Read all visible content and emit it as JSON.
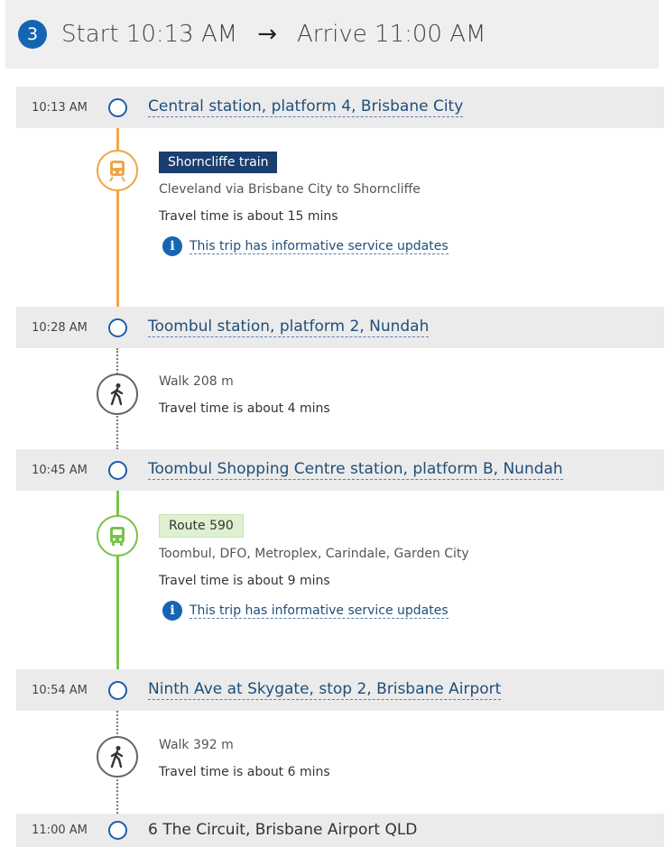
{
  "header": {
    "step_number": "3",
    "start": "Start 10:13 AM",
    "arrow": "→",
    "arrive": "Arrive 11:00 AM"
  },
  "stops": [
    {
      "time": "10:13 AM",
      "name": "Central station, platform 4, Brisbane City"
    },
    {
      "time": "10:28 AM",
      "name": "Toombul station, platform 2, Nundah"
    },
    {
      "time": "10:45 AM",
      "name": "Toombul Shopping Centre station, platform B, Nundah"
    },
    {
      "time": "10:54 AM",
      "name": "Ninth Ave at Skygate, stop 2, Brisbane Airport"
    },
    {
      "time": "11:00 AM",
      "name": "6 The Circuit, Brisbane Airport QLD"
    }
  ],
  "legs": [
    {
      "mode": "train",
      "icon": "train-icon",
      "service": "Shorncliffe train",
      "route_desc": "Cleveland via Brisbane City to Shorncliffe",
      "travel_time": "Travel time is about 15 mins",
      "update": "This trip has informative service updates"
    },
    {
      "mode": "walk",
      "icon": "walk-icon",
      "distance": "Walk 208 m",
      "travel_time": "Travel time is about 4 mins"
    },
    {
      "mode": "bus",
      "icon": "bus-icon",
      "service": "Route 590",
      "route_desc": "Toombul, DFO, Metroplex, Carindale, Garden City",
      "travel_time": "Travel time is about 9 mins",
      "update": "This trip has informative service updates"
    },
    {
      "mode": "walk",
      "icon": "walk-icon",
      "distance": "Walk 392 m",
      "travel_time": "Travel time is about 6 mins"
    }
  ],
  "colors": {
    "accent_blue": "#1565b3",
    "train_orange": "#f0a54a",
    "bus_green": "#7ac24a",
    "train_tag_bg": "#1a3e6e",
    "bus_tag_bg": "#dff0d2"
  }
}
